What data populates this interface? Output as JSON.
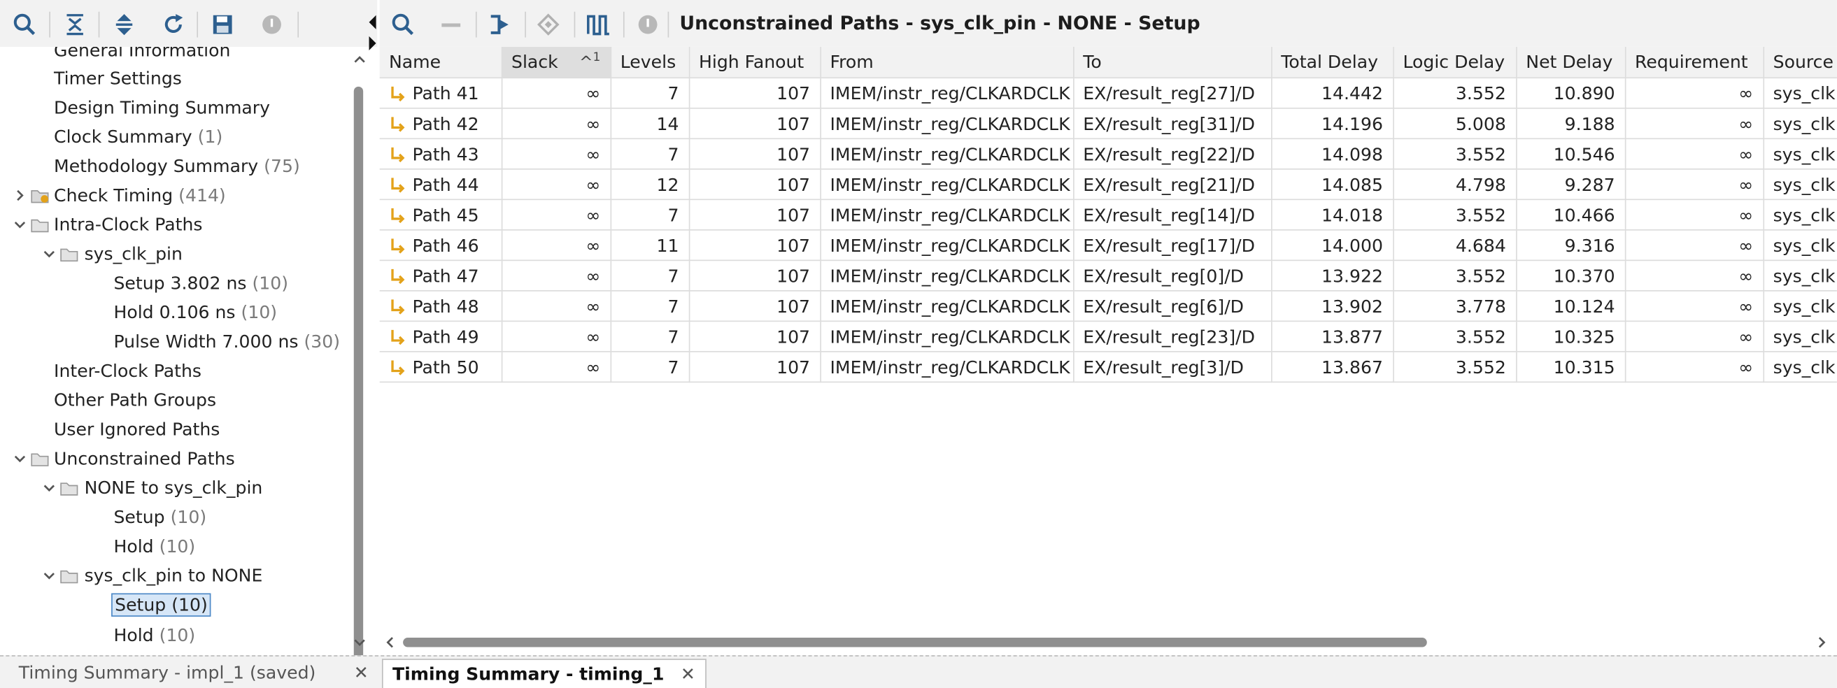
{
  "left_toolbar": {
    "icons": [
      "search-icon",
      "collapse-all-icon",
      "expand-all-icon",
      "refresh-icon",
      "save-icon",
      "stop-icon"
    ]
  },
  "tree": {
    "items": [
      {
        "label": "General Information",
        "count": ""
      },
      {
        "label": "Timer Settings",
        "count": ""
      },
      {
        "label": "Design Timing Summary",
        "count": ""
      },
      {
        "label": "Clock Summary",
        "count": "(1)"
      },
      {
        "label": "Methodology Summary",
        "count": "(75)"
      },
      {
        "label": "Check Timing",
        "count": "(414)"
      },
      {
        "label": "Intra-Clock Paths",
        "count": ""
      },
      {
        "label": "sys_clk_pin",
        "count": ""
      },
      {
        "label": "Setup 3.802 ns",
        "count": "(10)"
      },
      {
        "label": "Hold 0.106 ns",
        "count": "(10)"
      },
      {
        "label": "Pulse Width 7.000 ns",
        "count": "(30)"
      },
      {
        "label": "Inter-Clock Paths",
        "count": ""
      },
      {
        "label": "Other Path Groups",
        "count": ""
      },
      {
        "label": "User Ignored Paths",
        "count": ""
      },
      {
        "label": "Unconstrained Paths",
        "count": ""
      },
      {
        "label": "NONE to sys_clk_pin",
        "count": ""
      },
      {
        "label": "Setup",
        "count": "(10)"
      },
      {
        "label": "Hold",
        "count": "(10)"
      },
      {
        "label": "sys_clk_pin to NONE",
        "count": ""
      },
      {
        "label": "Setup (10)",
        "count": ""
      },
      {
        "label": "Hold",
        "count": "(10)"
      }
    ]
  },
  "right_toolbar": {
    "title": "Unconstrained Paths - sys_clk_pin - NONE - Setup",
    "icons": [
      "search-icon",
      "minus-icon",
      "goto-icon",
      "diamond-icon",
      "waveform-icon",
      "stop-icon"
    ]
  },
  "table": {
    "columns": [
      "Name",
      "Slack",
      "Levels",
      "High Fanout",
      "From",
      "To",
      "Total Delay",
      "Logic Delay",
      "Net Delay",
      "Requirement",
      "Source Clock"
    ],
    "sort_indicator": "^",
    "sort_rank": "1",
    "rows": [
      {
        "name": "Path 41",
        "slack": "∞",
        "levels": "7",
        "fanout": "107",
        "from": "IMEM/instr_reg/CLKARDCLK",
        "to": "EX/result_reg[27]/D",
        "total": "14.442",
        "logic": "3.552",
        "net": "10.890",
        "req": "∞",
        "src": "sys_clk"
      },
      {
        "name": "Path 42",
        "slack": "∞",
        "levels": "14",
        "fanout": "107",
        "from": "IMEM/instr_reg/CLKARDCLK",
        "to": "EX/result_reg[31]/D",
        "total": "14.196",
        "logic": "5.008",
        "net": "9.188",
        "req": "∞",
        "src": "sys_clk"
      },
      {
        "name": "Path 43",
        "slack": "∞",
        "levels": "7",
        "fanout": "107",
        "from": "IMEM/instr_reg/CLKARDCLK",
        "to": "EX/result_reg[22]/D",
        "total": "14.098",
        "logic": "3.552",
        "net": "10.546",
        "req": "∞",
        "src": "sys_clk"
      },
      {
        "name": "Path 44",
        "slack": "∞",
        "levels": "12",
        "fanout": "107",
        "from": "IMEM/instr_reg/CLKARDCLK",
        "to": "EX/result_reg[21]/D",
        "total": "14.085",
        "logic": "4.798",
        "net": "9.287",
        "req": "∞",
        "src": "sys_clk"
      },
      {
        "name": "Path 45",
        "slack": "∞",
        "levels": "7",
        "fanout": "107",
        "from": "IMEM/instr_reg/CLKARDCLK",
        "to": "EX/result_reg[14]/D",
        "total": "14.018",
        "logic": "3.552",
        "net": "10.466",
        "req": "∞",
        "src": "sys_clk"
      },
      {
        "name": "Path 46",
        "slack": "∞",
        "levels": "11",
        "fanout": "107",
        "from": "IMEM/instr_reg/CLKARDCLK",
        "to": "EX/result_reg[17]/D",
        "total": "14.000",
        "logic": "4.684",
        "net": "9.316",
        "req": "∞",
        "src": "sys_clk"
      },
      {
        "name": "Path 47",
        "slack": "∞",
        "levels": "7",
        "fanout": "107",
        "from": "IMEM/instr_reg/CLKARDCLK",
        "to": "EX/result_reg[0]/D",
        "total": "13.922",
        "logic": "3.552",
        "net": "10.370",
        "req": "∞",
        "src": "sys_clk"
      },
      {
        "name": "Path 48",
        "slack": "∞",
        "levels": "7",
        "fanout": "107",
        "from": "IMEM/instr_reg/CLKARDCLK",
        "to": "EX/result_reg[6]/D",
        "total": "13.902",
        "logic": "3.778",
        "net": "10.124",
        "req": "∞",
        "src": "sys_clk"
      },
      {
        "name": "Path 49",
        "slack": "∞",
        "levels": "7",
        "fanout": "107",
        "from": "IMEM/instr_reg/CLKARDCLK",
        "to": "EX/result_reg[23]/D",
        "total": "13.877",
        "logic": "3.552",
        "net": "10.325",
        "req": "∞",
        "src": "sys_clk"
      },
      {
        "name": "Path 50",
        "slack": "∞",
        "levels": "7",
        "fanout": "107",
        "from": "IMEM/instr_reg/CLKARDCLK",
        "to": "EX/result_reg[3]/D",
        "total": "13.867",
        "logic": "3.552",
        "net": "10.315",
        "req": "∞",
        "src": "sys_clk"
      }
    ]
  },
  "bottom_tabs": [
    {
      "label": "Timing Summary - impl_1 (saved)",
      "active": false
    },
    {
      "label": "Timing Summary - timing_1",
      "active": true
    }
  ],
  "close_glyph": "✕",
  "colors": {
    "accent": "#3f7fc1",
    "path_icon": "#e3a21a",
    "selection": "#d6e6f7"
  }
}
